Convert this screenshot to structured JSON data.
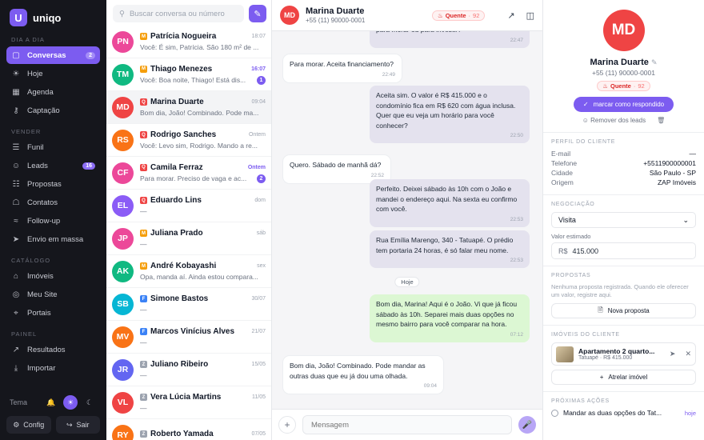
{
  "brand": {
    "name": "uniqo",
    "logo_letter": "U",
    "accent": "#7c5cf0"
  },
  "sidebar": {
    "sections": [
      {
        "label": "DIA A DIA",
        "items": [
          {
            "key": "conversas",
            "label": "Conversas",
            "icon": "chat-icon",
            "badge": "2",
            "active": true
          },
          {
            "key": "hoje",
            "label": "Hoje",
            "icon": "sun-icon"
          },
          {
            "key": "agenda",
            "label": "Agenda",
            "icon": "calendar-icon"
          },
          {
            "key": "captacao",
            "label": "Captação",
            "icon": "key-icon"
          }
        ]
      },
      {
        "label": "VENDER",
        "items": [
          {
            "key": "funil",
            "label": "Funil",
            "icon": "funnel-icon"
          },
          {
            "key": "leads",
            "label": "Leads",
            "icon": "users-icon",
            "badge": "16"
          },
          {
            "key": "propostas",
            "label": "Propostas",
            "icon": "document-icon"
          },
          {
            "key": "contatos",
            "label": "Contatos",
            "icon": "address-book-icon"
          },
          {
            "key": "followup",
            "label": "Follow-up",
            "icon": "wave-icon"
          },
          {
            "key": "envio",
            "label": "Envio em massa",
            "icon": "send-icon"
          }
        ]
      },
      {
        "label": "CATÁLOGO",
        "items": [
          {
            "key": "imoveis",
            "label": "Imóveis",
            "icon": "building-icon"
          },
          {
            "key": "meusite",
            "label": "Meu Site",
            "icon": "globe-icon"
          },
          {
            "key": "portais",
            "label": "Portais",
            "icon": "portal-icon"
          }
        ]
      },
      {
        "label": "PAINEL",
        "items": [
          {
            "key": "resultados",
            "label": "Resultados",
            "icon": "chart-icon"
          },
          {
            "key": "importar",
            "label": "Importar",
            "icon": "download-icon"
          }
        ]
      }
    ],
    "theme_label": "Tema",
    "config_label": "Config",
    "logout_label": "Sair"
  },
  "conversation_list": {
    "search_placeholder": "Buscar conversa ou número",
    "items": [
      {
        "initials": "PN",
        "color": "#ec4899",
        "source": "M",
        "source_color": "#f59e0b",
        "name": "Patrícia Nogueira",
        "time": "18:07",
        "preview": "Você: É sim, Patrícia. São 180 m² de ...",
        "unread": ""
      },
      {
        "initials": "TM",
        "color": "#10b981",
        "source": "M",
        "source_color": "#f59e0b",
        "name": "Thiago Menezes",
        "time": "16:07",
        "preview": "Você: Boa noite, Thiago! Está dis...",
        "unread": "1"
      },
      {
        "initials": "MD",
        "color": "#ef4444",
        "source": "Q",
        "source_color": "#ef4444",
        "name": "Marina Duarte",
        "time": "09:04",
        "preview": "Bom dia, João! Combinado. Pode ma...",
        "unread": "",
        "selected": true
      },
      {
        "initials": "RS",
        "color": "#f97316",
        "source": "Q",
        "source_color": "#ef4444",
        "name": "Rodrigo Sanches",
        "time": "Ontem",
        "preview": "Você: Levo sim, Rodrigo. Mando a re...",
        "unread": ""
      },
      {
        "initials": "CF",
        "color": "#ec4899",
        "source": "Q",
        "source_color": "#ef4444",
        "name": "Camila Ferraz",
        "time": "Ontem",
        "preview": "Para morar. Preciso de vaga e ac...",
        "unread": "2"
      },
      {
        "initials": "EL",
        "color": "#8b5cf6",
        "source": "Q",
        "source_color": "#ef4444",
        "name": "Eduardo Lins",
        "time": "dom",
        "preview": "—",
        "unread": ""
      },
      {
        "initials": "JP",
        "color": "#ec4899",
        "source": "M",
        "source_color": "#f59e0b",
        "name": "Juliana Prado",
        "time": "sáb",
        "preview": "—",
        "unread": ""
      },
      {
        "initials": "AK",
        "color": "#10b981",
        "source": "M",
        "source_color": "#f59e0b",
        "name": "André Kobayashi",
        "time": "sex",
        "preview": "Opa, manda aí. Ainda estou compara...",
        "unread": ""
      },
      {
        "initials": "SB",
        "color": "#06b6d4",
        "source": "F",
        "source_color": "#3b82f6",
        "name": "Simone Bastos",
        "time": "30/07",
        "preview": "—",
        "unread": ""
      },
      {
        "initials": "MV",
        "color": "#f97316",
        "source": "F",
        "source_color": "#3b82f6",
        "name": "Marcos Vinícius Alves",
        "time": "21/07",
        "preview": "—",
        "unread": ""
      },
      {
        "initials": "JR",
        "color": "#6366f1",
        "source": "Z",
        "source_color": "#9ca3af",
        "name": "Juliano Ribeiro",
        "time": "15/05",
        "preview": "—",
        "unread": ""
      },
      {
        "initials": "VL",
        "color": "#ef4444",
        "source": "Z",
        "source_color": "#9ca3af",
        "name": "Vera Lúcia Martins",
        "time": "11/05",
        "preview": "—",
        "unread": ""
      },
      {
        "initials": "RY",
        "color": "#f97316",
        "source": "Z",
        "source_color": "#9ca3af",
        "name": "Roberto Yamada",
        "time": "07/05",
        "preview": "",
        "unread": ""
      }
    ]
  },
  "chat": {
    "contact": {
      "initials": "MD",
      "name": "Marina Duarte",
      "phone": "+55 (11) 90000-0001",
      "temperature": "Quente",
      "score": "92"
    },
    "date_chip": "Hoje",
    "messages": [
      {
        "dir": "out",
        "text": "para morar ou para investir?",
        "time": "22:47"
      },
      {
        "dir": "in",
        "text": "Para morar. Aceita financiamento?",
        "time": "22:49"
      },
      {
        "dir": "out",
        "text": "Aceita sim. O valor é R$ 415.000 e o condomínio fica em R$ 620 com água inclusa. Quer que eu veja um horário para você conhecer?",
        "time": "22:50"
      },
      {
        "dir": "in",
        "text": "Quero. Sábado de manhã dá?",
        "time": "22:52"
      },
      {
        "dir": "out",
        "text": "Perfeito. Deixei sábado às 10h com o João e mandei o endereço aqui. Na sexta eu confirmo com você.",
        "time": "22:53"
      },
      {
        "dir": "out",
        "text": "Rua Emília Marengo, 340 - Tatuapé. O prédio tem portaria 24 horas, é só falar meu nome.",
        "time": "22:53"
      },
      {
        "dir": "out",
        "green": true,
        "text": "Bom dia, Marina! Aqui é o João. Vi que já ficou sábado às 10h. Separei mais duas opções no mesmo bairro para você comparar na hora.",
        "time": "07:12"
      },
      {
        "dir": "in",
        "text": "Bom dia, João! Combinado. Pode mandar as outras duas que eu já dou uma olhada.",
        "time": "09:04"
      }
    ],
    "composer_placeholder": "Mensagem"
  },
  "profile": {
    "initials": "MD",
    "name": "Marina Duarte",
    "phone": "+55 (11) 90000-0001",
    "temperature": "Quente",
    "score": "92",
    "mark_label": "marcar como respondido",
    "remove_label": "Remover dos leads",
    "client_title": "PERFIL DO CLIENTE",
    "fields": [
      {
        "k": "E-mail",
        "v": "—"
      },
      {
        "k": "Telefone",
        "v": "+5511900000001"
      },
      {
        "k": "Cidade",
        "v": "São Paulo - SP"
      },
      {
        "k": "Origem",
        "v": "ZAP Imóveis"
      }
    ],
    "negotiation_title": "NEGOCIAÇÃO",
    "stage": "Visita",
    "estimated_label": "Valor estimado",
    "currency": "R$",
    "estimated_value": "415.000",
    "proposals_title": "PROPOSTAS",
    "proposals_empty": "Nenhuma proposta registrada. Quando ele oferecer um valor, registre aqui.",
    "new_proposal_label": "Nova proposta",
    "properties_title": "IMÓVEIS DO CLIENTE",
    "property": {
      "title": "Apartamento 2 quarto...",
      "subtitle": "Tatuapé · R$ 415.000"
    },
    "attach_label": "Atrelar imóvel",
    "next_title": "PRÓXIMAS AÇÕES",
    "next_task": "Mandar as duas opções do Tat...",
    "next_due": "hoje"
  }
}
